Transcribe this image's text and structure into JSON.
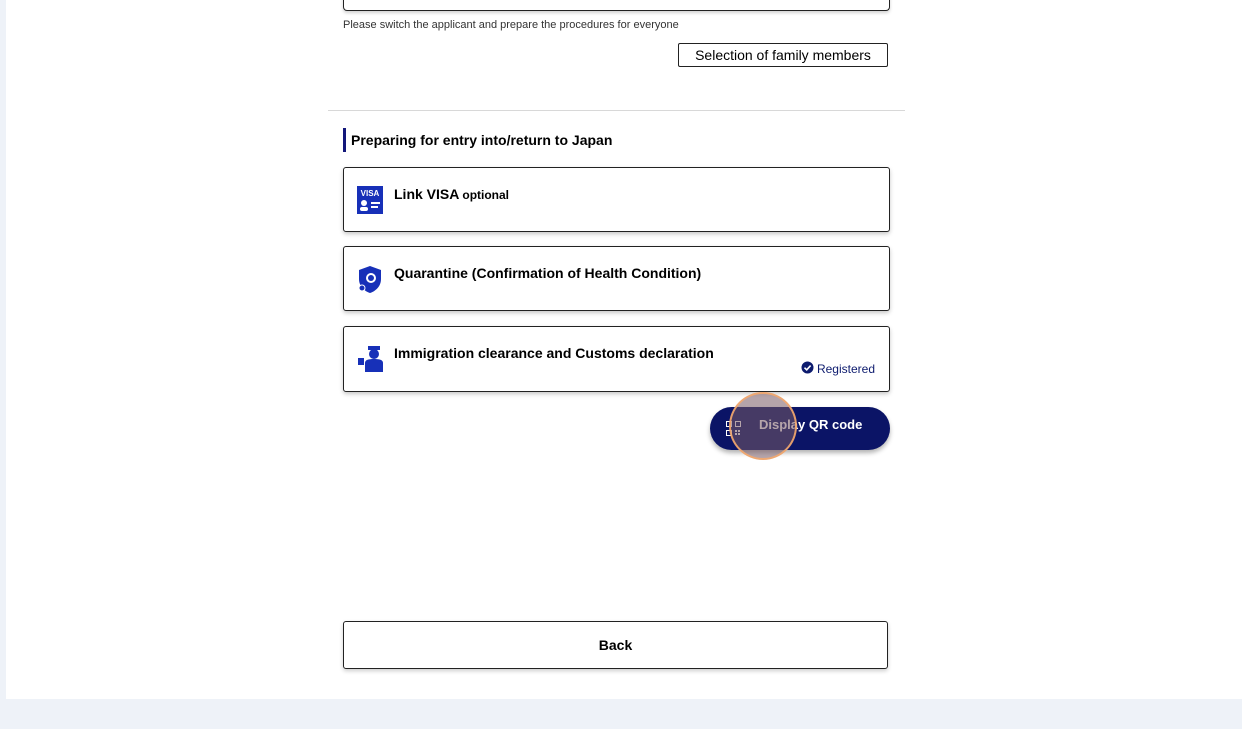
{
  "applicant_note": "Please switch the applicant and prepare the procedures for everyone",
  "family_button_label": "Selection of family members",
  "section": {
    "title": "Preparing for entry into/return to Japan"
  },
  "cards": [
    {
      "title": "Link VISA",
      "tag": "optional",
      "icon": "visa-icon",
      "visa_text": "VISA"
    },
    {
      "title": "Quarantine (Confirmation of Health Condition)",
      "icon": "quarantine-shield-icon"
    },
    {
      "title": "Immigration clearance and Customs declaration",
      "icon": "immigration-officer-icon",
      "status": "Registered"
    }
  ],
  "qr_button_label": "Display QR code",
  "back_button_label": "Back",
  "colors": {
    "accent": "#13177a",
    "qr_button_bg": "#0b1466",
    "page_bg": "#eef2f8"
  }
}
